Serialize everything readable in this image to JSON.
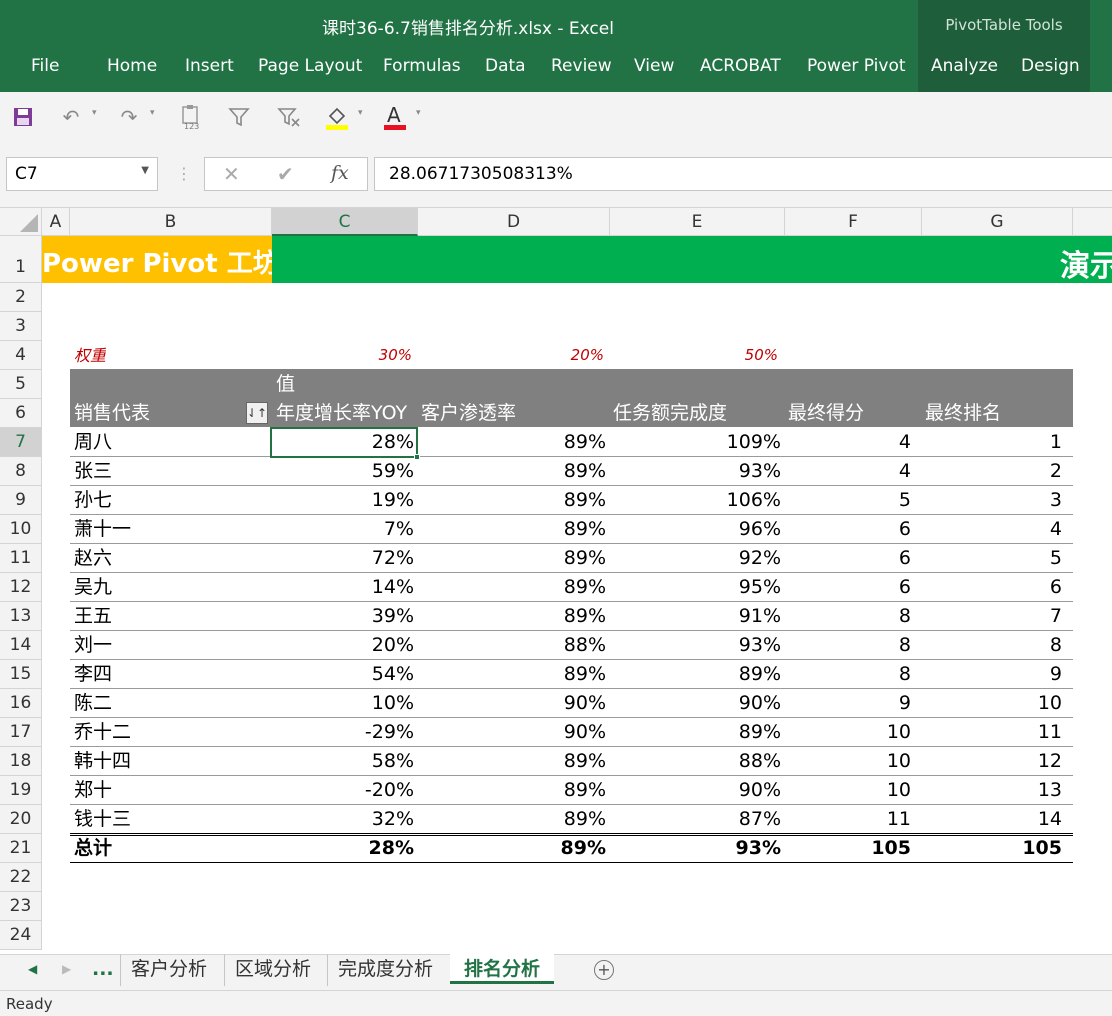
{
  "window": {
    "title": "课时36-6.7销售排名分析.xlsx - Excel",
    "context_tab_group": "PivotTable Tools"
  },
  "ribbon_tabs": [
    "File",
    "Home",
    "Insert",
    "Page Layout",
    "Formulas",
    "Data",
    "Review",
    "View",
    "ACROBAT",
    "Power Pivot",
    "Analyze",
    "Design"
  ],
  "qat": {
    "icons": [
      "save-icon",
      "undo-icon",
      "redo-icon",
      "paste-values-icon",
      "filter-icon",
      "clear-filter-icon",
      "fill-color-icon",
      "font-color-icon"
    ],
    "paste_badge": "123",
    "font_color_glyph": "A"
  },
  "formula_bar": {
    "name_box": "C7",
    "cancel": "✕",
    "enter": "✔",
    "fx": "fx",
    "value": "28.0671730508313%"
  },
  "columns": [
    "A",
    "B",
    "C",
    "D",
    "E",
    "F",
    "G"
  ],
  "rows": [
    "1",
    "2",
    "3",
    "4",
    "5",
    "6",
    "7",
    "8",
    "9",
    "10",
    "11",
    "12",
    "13",
    "14",
    "15",
    "16",
    "17",
    "18",
    "19",
    "20",
    "21",
    "22",
    "23",
    "24"
  ],
  "banner": {
    "left": "Power Pivot 工坊",
    "right": "演示"
  },
  "weights": {
    "label": "权重",
    "c": "30%",
    "d": "20%",
    "e": "50%"
  },
  "pivot": {
    "values_label": "值",
    "headers": [
      "销售代表",
      "年度增长率YOY",
      "客户渗透率",
      "任务额完成度",
      "最终得分",
      "最终排名"
    ],
    "rows": [
      [
        "周八",
        "28%",
        "89%",
        "109%",
        "4",
        "1"
      ],
      [
        "张三",
        "59%",
        "89%",
        "93%",
        "4",
        "2"
      ],
      [
        "孙七",
        "19%",
        "89%",
        "106%",
        "5",
        "3"
      ],
      [
        "萧十一",
        "7%",
        "89%",
        "96%",
        "6",
        "4"
      ],
      [
        "赵六",
        "72%",
        "89%",
        "92%",
        "6",
        "5"
      ],
      [
        "吴九",
        "14%",
        "89%",
        "95%",
        "6",
        "6"
      ],
      [
        "王五",
        "39%",
        "89%",
        "91%",
        "8",
        "7"
      ],
      [
        "刘一",
        "20%",
        "88%",
        "93%",
        "8",
        "8"
      ],
      [
        "李四",
        "54%",
        "89%",
        "89%",
        "8",
        "9"
      ],
      [
        "陈二",
        "10%",
        "90%",
        "90%",
        "9",
        "10"
      ],
      [
        "乔十二",
        "-29%",
        "90%",
        "89%",
        "10",
        "11"
      ],
      [
        "韩十四",
        "58%",
        "89%",
        "88%",
        "10",
        "12"
      ],
      [
        "郑十",
        "-20%",
        "89%",
        "90%",
        "10",
        "13"
      ],
      [
        "钱十三",
        "32%",
        "89%",
        "87%",
        "11",
        "14"
      ]
    ],
    "total": [
      "总计",
      "28%",
      "89%",
      "93%",
      "105",
      "105"
    ]
  },
  "sheet_tabs": {
    "ellipsis": "...",
    "tabs": [
      "客户分析",
      "区域分析",
      "完成度分析",
      "排名分析"
    ],
    "active": "排名分析",
    "add": "+"
  },
  "status": {
    "text": "Ready"
  },
  "colors": {
    "excel_green": "#217346",
    "banner_yellow": "#FFC000",
    "banner_green": "#00B050",
    "header_gray": "#808080",
    "weight_red": "#C00000"
  }
}
